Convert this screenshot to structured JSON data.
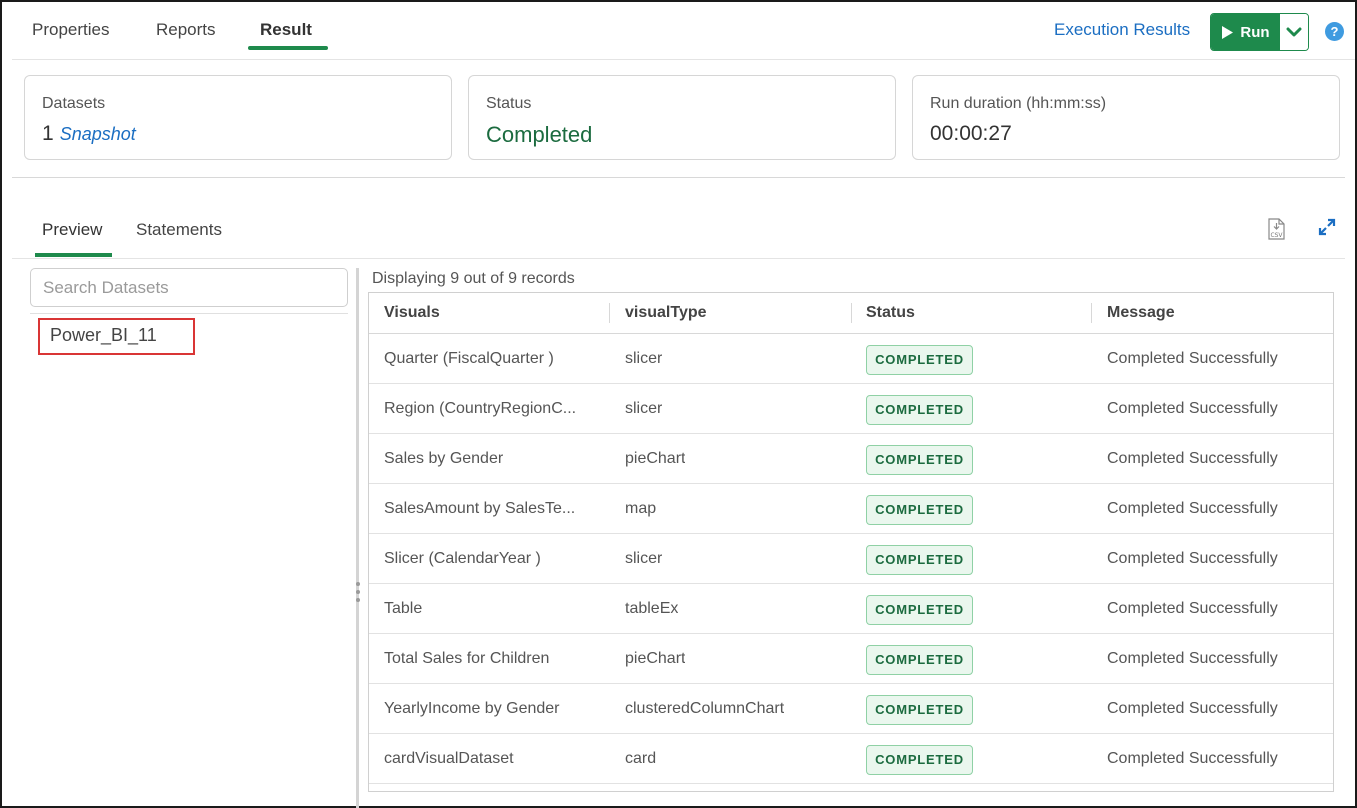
{
  "top_tabs": [
    {
      "label": "Properties"
    },
    {
      "label": "Reports"
    },
    {
      "label": "Result"
    }
  ],
  "header": {
    "execution_results_label": "Execution Results",
    "run_label": "Run",
    "help_label": "?"
  },
  "cards": {
    "datasets": {
      "label": "Datasets",
      "count": "1",
      "link": "Snapshot"
    },
    "status": {
      "label": "Status",
      "value": "Completed"
    },
    "duration": {
      "label": "Run duration (hh:mm:ss)",
      "value": "00:00:27"
    }
  },
  "sub_tabs": [
    {
      "label": "Preview"
    },
    {
      "label": "Statements"
    }
  ],
  "csv_icon_text": "CSV",
  "search": {
    "placeholder": "Search Datasets",
    "value": ""
  },
  "datasets": [
    {
      "name": "Power_BI_11"
    }
  ],
  "records_text": "Displaying 9 out of 9 records",
  "table": {
    "columns": [
      "Visuals",
      "visualType",
      "Status",
      "Message"
    ],
    "rows": [
      {
        "visual": "Quarter (FiscalQuarter )",
        "type": "slicer",
        "status": "COMPLETED",
        "message": "Completed Successfully"
      },
      {
        "visual": "Region (CountryRegionC...",
        "type": "slicer",
        "status": "COMPLETED",
        "message": "Completed Successfully"
      },
      {
        "visual": "Sales by Gender",
        "type": "pieChart",
        "status": "COMPLETED",
        "message": "Completed Successfully"
      },
      {
        "visual": "SalesAmount by SalesTe...",
        "type": "map",
        "status": "COMPLETED",
        "message": "Completed Successfully"
      },
      {
        "visual": "Slicer (CalendarYear )",
        "type": "slicer",
        "status": "COMPLETED",
        "message": "Completed Successfully"
      },
      {
        "visual": "Table",
        "type": "tableEx",
        "status": "COMPLETED",
        "message": "Completed Successfully"
      },
      {
        "visual": "Total Sales for Children",
        "type": "pieChart",
        "status": "COMPLETED",
        "message": "Completed Successfully"
      },
      {
        "visual": "YearlyIncome by Gender",
        "type": "clusteredColumnChart",
        "status": "COMPLETED",
        "message": "Completed Successfully"
      },
      {
        "visual": "cardVisualDataset",
        "type": "card",
        "status": "COMPLETED",
        "message": "Completed Successfully"
      }
    ]
  },
  "colors": {
    "accent_green": "#1e8a4c",
    "link_blue": "#1b6ec2",
    "status_green_text": "#1b6b3f",
    "badge_bg": "#eaf7ee",
    "selected_outline": "#d93535"
  }
}
